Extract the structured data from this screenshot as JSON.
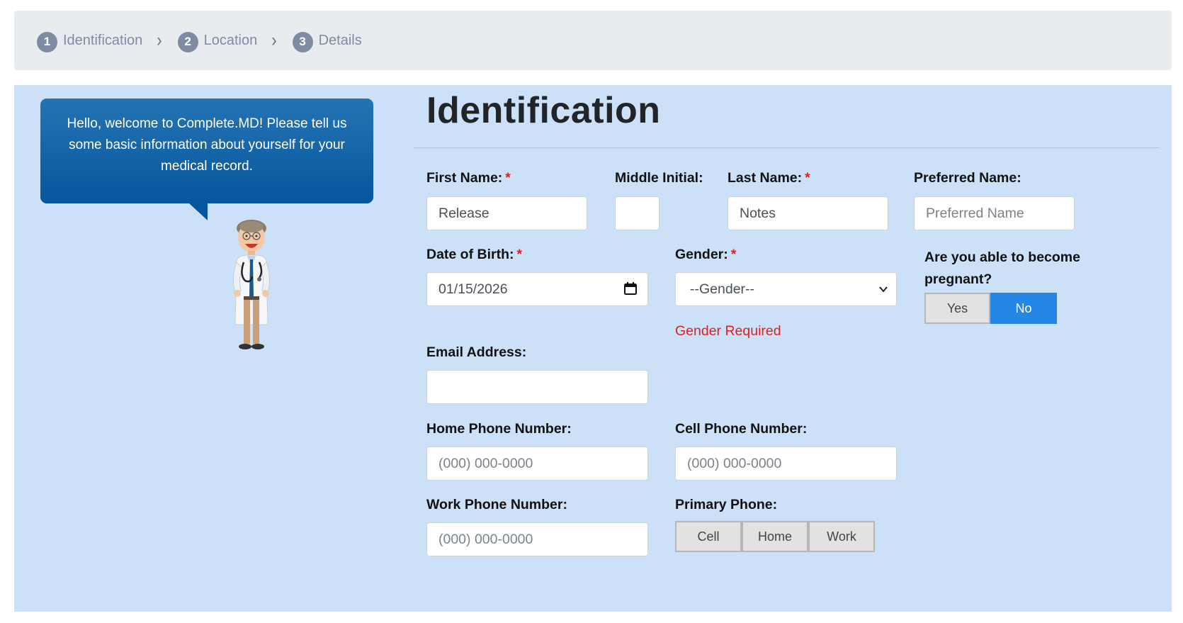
{
  "stepper": {
    "steps": [
      {
        "num": "1",
        "label": "Identification"
      },
      {
        "num": "2",
        "label": "Location"
      },
      {
        "num": "3",
        "label": "Details"
      }
    ],
    "separator_icon": "chevron-right-icon"
  },
  "assistant": {
    "message": "Hello, welcome to Complete.MD! Please tell us some basic information about yourself for your medical record.",
    "avatar_icon": "doctor-illustration"
  },
  "form": {
    "title": "Identification",
    "first_name": {
      "label": "First Name:",
      "value": "Release",
      "required": "*"
    },
    "middle_initial": {
      "label": "Middle Initial:",
      "value": ""
    },
    "last_name": {
      "label": "Last Name:",
      "value": "Notes",
      "required": "*"
    },
    "preferred_name": {
      "label": "Preferred Name:",
      "value": "",
      "placeholder": "Preferred Name"
    },
    "dob": {
      "label": "Date of Birth:",
      "value": "01/15/2026",
      "required": "*"
    },
    "gender": {
      "label": "Gender:",
      "selected": "--Gender--",
      "required": "*",
      "error": "Gender Required"
    },
    "pregnant": {
      "label": "Are you able to become pregnant?",
      "options": [
        "Yes",
        "No"
      ],
      "selected": "No"
    },
    "email": {
      "label": "Email Address:",
      "value": ""
    },
    "home_phone": {
      "label": "Home Phone Number:",
      "placeholder": "(000) 000-0000"
    },
    "cell_phone": {
      "label": "Cell Phone Number:",
      "placeholder": "(000) 000-0000"
    },
    "work_phone": {
      "label": "Work Phone Number:",
      "placeholder": "(000) 000-0000"
    },
    "primary_phone": {
      "label": "Primary Phone:",
      "options": [
        "Cell",
        "Home",
        "Work"
      ]
    }
  },
  "colors": {
    "panel_bg": "#cce1f8",
    "accent": "#2486e5",
    "error": "#e0201f",
    "bubble": "#06569e"
  }
}
